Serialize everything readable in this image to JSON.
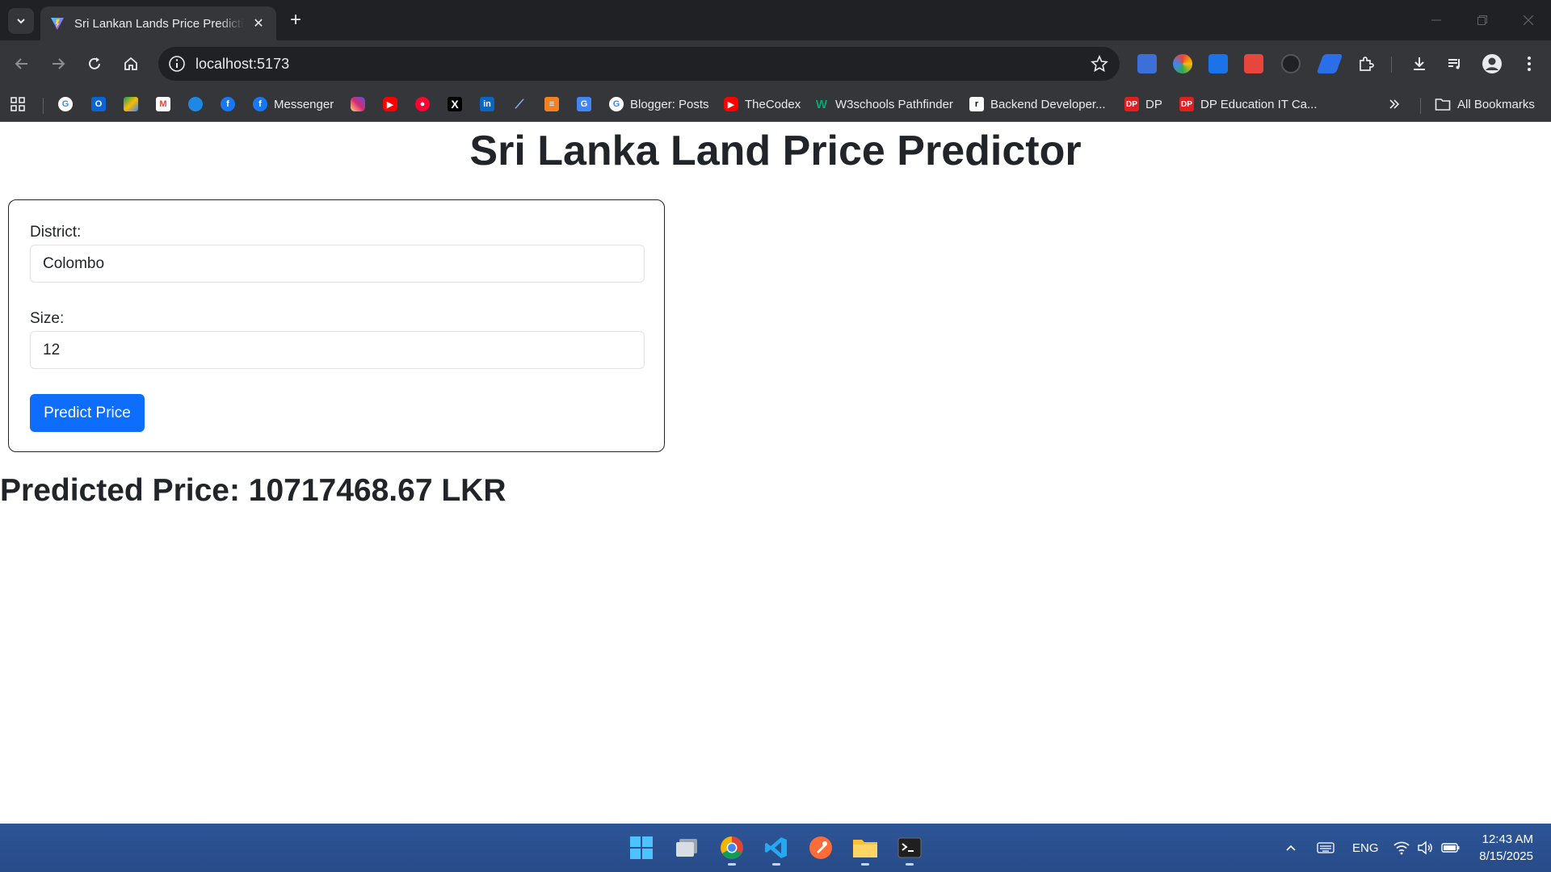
{
  "browser": {
    "tab_title": "Sri Lankan Lands Price Prediction",
    "url": "localhost:5173",
    "bookmarks": [
      {
        "label": "",
        "icon": "google-icon"
      },
      {
        "label": "",
        "icon": "outlook-icon"
      },
      {
        "label": "",
        "icon": "google-drive-icon"
      },
      {
        "label": "",
        "icon": "gmail-icon"
      },
      {
        "label": "",
        "icon": "onedrive-icon"
      },
      {
        "label": "",
        "icon": "facebook-icon"
      },
      {
        "label": "Messenger",
        "icon": "facebook-icon"
      },
      {
        "label": "",
        "icon": "instagram-icon"
      },
      {
        "label": "",
        "icon": "youtube-icon"
      },
      {
        "label": "",
        "icon": "youtube-music-icon"
      },
      {
        "label": "",
        "icon": "x-icon"
      },
      {
        "label": "",
        "icon": "linkedin-icon"
      },
      {
        "label": "",
        "icon": "link-icon"
      },
      {
        "label": "",
        "icon": "stackoverflow-icon"
      },
      {
        "label": "",
        "icon": "translate-icon"
      },
      {
        "label": "Blogger: Posts",
        "icon": "google-icon"
      },
      {
        "label": "TheCodex",
        "icon": "youtube-icon"
      },
      {
        "label": "W3schools Pathfinder",
        "icon": "w3schools-icon"
      },
      {
        "label": "Backend Developer...",
        "icon": "roadmap-icon"
      },
      {
        "label": "DP",
        "icon": "dp-icon"
      },
      {
        "label": "DP Education IT Ca...",
        "icon": "dp-icon"
      }
    ],
    "all_bookmarks_label": "All Bookmarks"
  },
  "page": {
    "title": "Sri Lanka Land Price Predictor",
    "form": {
      "district_label": "District:",
      "district_value": "Colombo",
      "size_label": "Size:",
      "size_value": "12",
      "submit_label": "Predict Price"
    },
    "result": "Predicted Price: 10717468.67 LKR"
  },
  "taskbar": {
    "language": "ENG",
    "time": "12:43 AM",
    "date": "8/15/2025"
  },
  "colors": {
    "primary_button": "#0d6efd",
    "browser_frame": "#202124",
    "browser_toolbar": "#35363a",
    "taskbar": "#2b4f8c"
  }
}
